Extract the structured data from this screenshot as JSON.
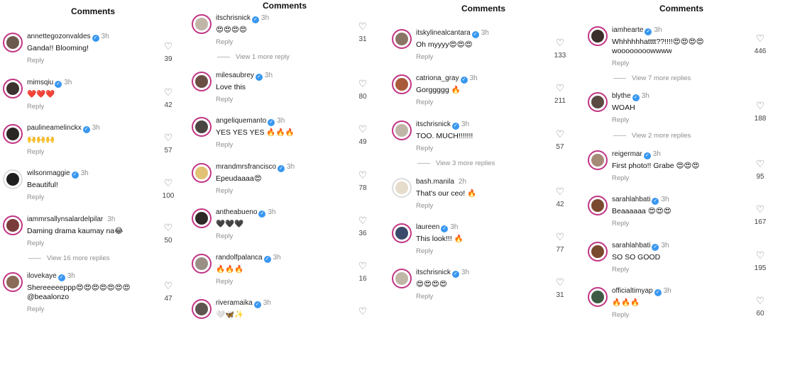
{
  "panels": [
    {
      "title": "Comments",
      "comments": [
        {
          "user": "annettegozonvaldes",
          "time": "3h",
          "text": "Ganda!! Blooming!",
          "likes": "39",
          "reply": "Reply"
        },
        {
          "user": "mimsqiu",
          "time": "3h",
          "text": "❤️❤️❤️",
          "likes": "42",
          "reply": "Reply"
        },
        {
          "user": "paulineamelinckx",
          "time": "3h",
          "text": "🙌🙌🙌",
          "likes": "57",
          "reply": "Reply"
        },
        {
          "user": "wilsonmaggie",
          "time": "3h",
          "text": "Beautiful!",
          "likes": "100",
          "reply": "Reply"
        },
        {
          "user": "iammrsallynsalardelpilar",
          "time": "3h",
          "text": "Daming drama kaumay na😂",
          "likes": "50",
          "reply": "Reply"
        },
        {
          "user": "ilovekaye",
          "time": "3h",
          "text": "Shereeeeeppp😍😍😍😍😍😍😍 @beaalonzo",
          "likes": "47",
          "reply": "Reply"
        }
      ],
      "more": "View 16 more replies"
    },
    {
      "title": "Comments",
      "comments": [
        {
          "user": "itschrisnick",
          "time": "3h",
          "text": "😍😍😍😍",
          "likes": "31",
          "reply": "Reply"
        },
        {
          "user": "milesaubrey",
          "time": "3h",
          "text": "Love this",
          "likes": "80",
          "reply": "Reply"
        },
        {
          "user": "angeliquemanto",
          "time": "3h",
          "text": "YES YES YES 🔥🔥🔥",
          "likes": "49",
          "reply": "Reply"
        },
        {
          "user": "mrandmrsfrancisco",
          "time": "3h",
          "text": "Epeudaaaa😍",
          "likes": "78",
          "reply": "Reply"
        },
        {
          "user": "antheabueno",
          "time": "3h",
          "text": "🖤🖤🖤",
          "likes": "36",
          "reply": "Reply"
        },
        {
          "user": "randolfpalanca",
          "time": "3h",
          "text": "🔥🔥🔥",
          "likes": "16",
          "reply": "Reply"
        },
        {
          "user": "riveramaika",
          "time": "3h",
          "text": "🤍🦋✨",
          "likes": "",
          "reply": ""
        }
      ],
      "more": "View 1 more reply"
    },
    {
      "title": "Comments",
      "comments": [
        {
          "user": "itskylinealcantara",
          "time": "3h",
          "text": "Oh myyyy😍😍😍",
          "likes": "133",
          "reply": "Reply"
        },
        {
          "user": "catriona_gray",
          "time": "3h",
          "text": "Gorggggg 🔥",
          "likes": "211",
          "reply": "Reply"
        },
        {
          "user": "itschrisnick",
          "time": "3h",
          "text": "TOO. MUCH!!!!!!!",
          "likes": "57",
          "reply": "Reply"
        },
        {
          "user": "bash.manila",
          "time": "2h",
          "text": "That's our ceo! 🔥",
          "likes": "42",
          "reply": "Reply"
        },
        {
          "user": "laureen",
          "time": "3h",
          "text": "This look!!! 🔥",
          "likes": "77",
          "reply": "Reply"
        },
        {
          "user": "itschrisnick",
          "time": "3h",
          "text": "😍😍😍😍",
          "likes": "31",
          "reply": "Reply"
        }
      ],
      "more": "View 3 more replies"
    },
    {
      "title": "Comments",
      "comments": [
        {
          "user": "iamhearte",
          "time": "3h",
          "text": "Whhhhhhatttt??!!!!😍😍😍😍 woooooooowwww",
          "likes": "446",
          "reply": "Reply"
        },
        {
          "user": "blythe",
          "time": "3h",
          "text": "WOAH",
          "likes": "188",
          "reply": "Reply"
        },
        {
          "user": "reigermar",
          "time": "3h",
          "text": "First photo!! Grabe 😍😍😍",
          "likes": "95",
          "reply": "Reply"
        },
        {
          "user": "sarahlahbati",
          "time": "3h",
          "text": "Beaaaaaa 😍😍😍",
          "likes": "167",
          "reply": "Reply"
        },
        {
          "user": "sarahlahbati",
          "time": "3h",
          "text": "SO SO GOOD",
          "likes": "195",
          "reply": "Reply"
        },
        {
          "user": "officialtimyap",
          "time": "3h",
          "text": "🔥🔥🔥",
          "likes": "60",
          "reply": "Reply"
        }
      ],
      "more": "View 7 more replies",
      "more2": "View 2 more replies"
    }
  ]
}
